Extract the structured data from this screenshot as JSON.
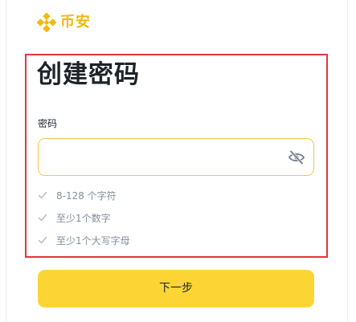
{
  "brand": {
    "name": "币安",
    "icon": "binance-diamond-icon",
    "color": "#F0B90B"
  },
  "page": {
    "title": "创建密码"
  },
  "password": {
    "label": "密码",
    "value": "",
    "placeholder": "",
    "visibility_icon": "eye-slash-icon"
  },
  "requirements": [
    {
      "text": "8-128 个字符",
      "icon": "check-icon"
    },
    {
      "text": "至少1个数字",
      "icon": "check-icon"
    },
    {
      "text": "至少1个大写字母",
      "icon": "check-icon"
    }
  ],
  "actions": {
    "next_label": "下一步"
  },
  "colors": {
    "accent": "#FCD535",
    "brand": "#F0B90B",
    "input_border": "#F0C94A",
    "highlight_border": "#E3353C",
    "muted_text": "#848E9C",
    "text": "#1E2329"
  }
}
